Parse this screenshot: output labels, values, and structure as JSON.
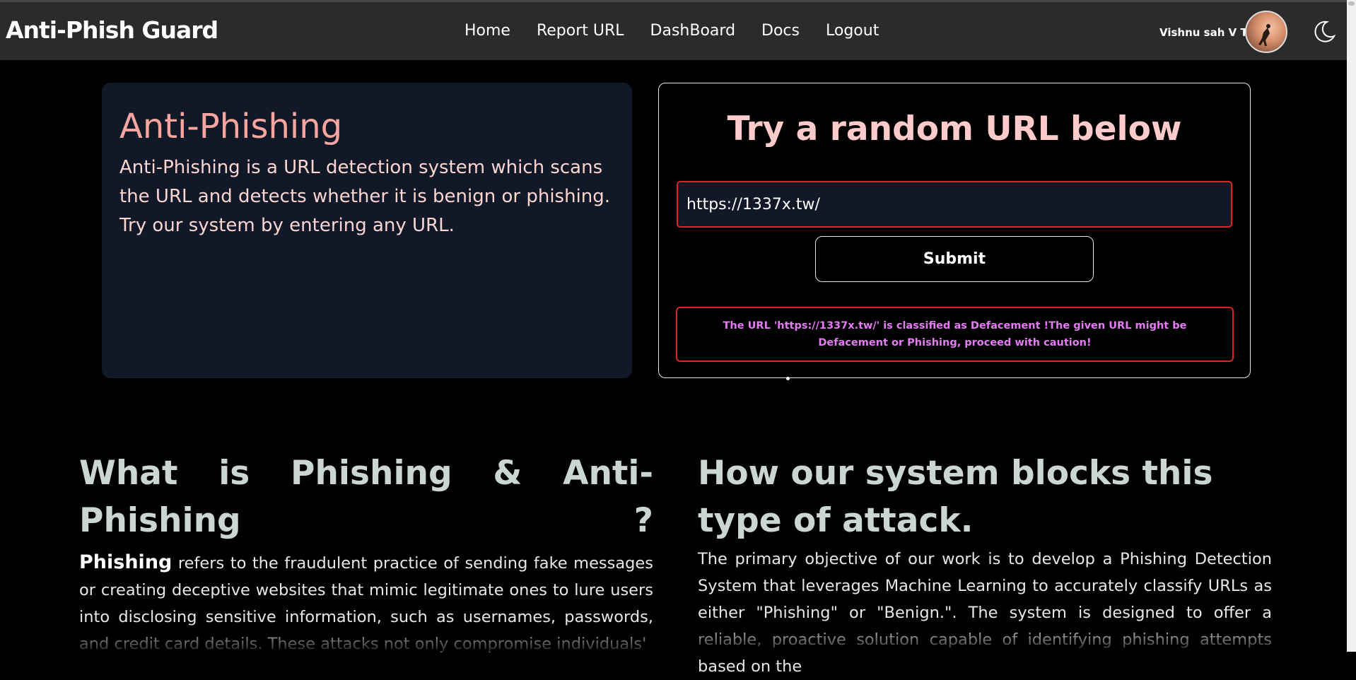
{
  "nav": {
    "brand": "Anti-Phish Guard",
    "items": [
      {
        "label": "Home"
      },
      {
        "label": "Report URL"
      },
      {
        "label": "DashBoard"
      },
      {
        "label": "Docs"
      },
      {
        "label": "Logout"
      }
    ],
    "user_name": "Vishnu sah V T",
    "theme_icon": "moon-icon"
  },
  "intro": {
    "title": "Anti-Phishing",
    "description": "Anti-Phishing is a URL detection system which scans the URL and detects whether it is benign or phishing. Try our system by entering any URL."
  },
  "checker": {
    "title": "Try a random URL below",
    "url_value": "https://1337x.tw/",
    "submit_label": "Submit",
    "result": "The URL 'https://1337x.tw/' is classified as Defacement !The given URL might be Defacement or Phishing, proceed with caution!"
  },
  "what_is": {
    "title": "What is Phishing & Anti-Phishing ?",
    "lead": "Phishing",
    "body": " refers to the fraudulent practice of sending fake messages or creating deceptive websites that mimic legitimate ones to lure users into disclosing sensitive information, such as usernames, passwords, and credit card details. These attacks not only compromise individuals'"
  },
  "how_blocks": {
    "title": "How our system blocks this type of attack.",
    "body": "The primary objective of our work is to develop a Phishing Detection System that leverages Machine Learning to accurately classify URLs as either \"Phishing\" or \"Benign.\". The system is designed to offer a reliable, proactive solution capable of identifying phishing attempts based on the"
  },
  "colors": {
    "accent_red": "#dc2626",
    "title_pink": "#fecaca",
    "result_text": "#e879f9",
    "nav_bg": "#2b2b2b"
  }
}
